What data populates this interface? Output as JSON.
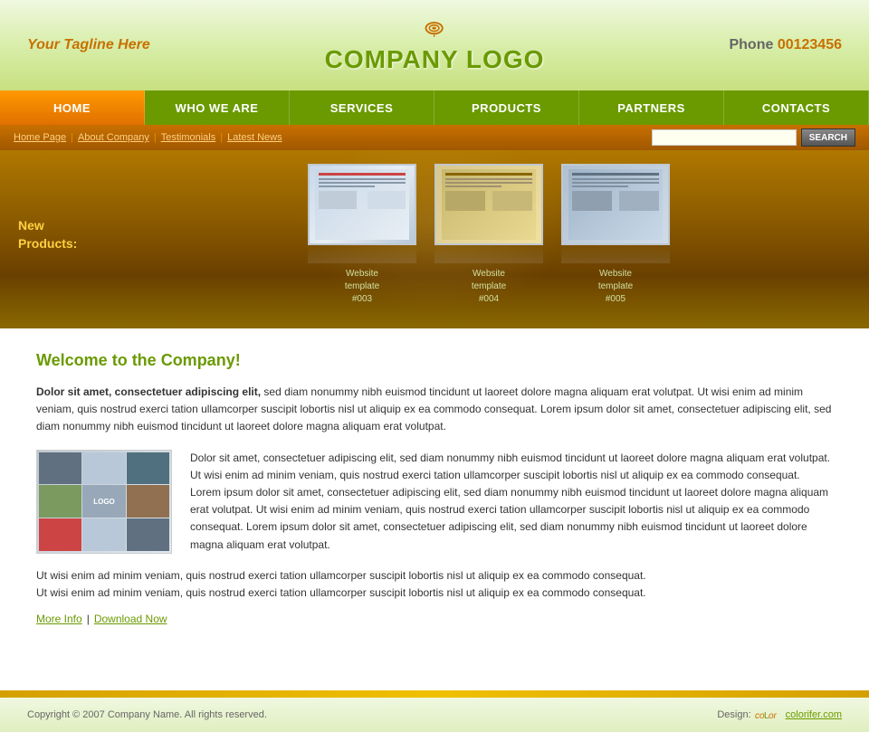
{
  "header": {
    "tagline": "Your Tagline Here",
    "logo": "COMPANY LOGO",
    "phone_label": "Phone",
    "phone_number": "00123456"
  },
  "nav": {
    "items": [
      {
        "label": "HOME",
        "active": true
      },
      {
        "label": "WHO WE ARE",
        "active": false
      },
      {
        "label": "SERVICES",
        "active": false
      },
      {
        "label": "PRODUCTS",
        "active": false
      },
      {
        "label": "PARTNERS",
        "active": false
      },
      {
        "label": "CONTACTS",
        "active": false
      }
    ]
  },
  "subnav": {
    "items": [
      "Home Page",
      "About Company",
      "Testimonials",
      "Latest News"
    ],
    "search_placeholder": "",
    "search_button": "SEARCH"
  },
  "banner": {
    "label": "New\nProducts:",
    "items": [
      {
        "caption_line1": "Website",
        "caption_line2": "template",
        "caption_line3": "#003"
      },
      {
        "caption_line1": "Website",
        "caption_line2": "template",
        "caption_line3": "#004"
      },
      {
        "caption_line1": "Website",
        "caption_line2": "template",
        "caption_line3": "#005"
      }
    ]
  },
  "main": {
    "welcome_title": "Welcome to the Company!",
    "intro_bold": "Dolor sit amet, consectetuer adipiscing elit,",
    "intro_text": " sed diam nonummy nibh euismod tincidunt ut laoreet dolore magna aliquam erat volutpat. Ut wisi enim ad minim veniam, quis nostrud exerci tation ullamcorper suscipit lobortis nisl ut aliquip ex ea commodo consequat. Lorem ipsum dolor sit amet, consectetuer adipiscing elit, sed diam nonummy nibh euismod tincidunt ut laoreet dolore magna aliquam erat volutpat.",
    "content_text": "Dolor sit amet, consectetuer adipiscing elit, sed diam nonummy nibh euismod tincidunt ut laoreet dolore magna aliquam erat volutpat. Ut wisi enim ad minim veniam, quis nostrud exerci tation ullamcorper suscipit lobortis nisl ut aliquip ex ea commodo consequat. Lorem ipsum dolor sit amet, consectetuer adipiscing elit, sed diam nonummy nibh euismod tincidunt ut laoreet dolore magna aliquam erat volutpat. Ut wisi enim ad minim veniam, quis nostrud exerci tation ullamcorper suscipit lobortis nisl ut aliquip ex ea commodo consequat. Lorem ipsum dolor sit amet, consectetuer adipiscing elit, sed diam nonummy nibh euismod tincidunt ut laoreet dolore magna aliquam erat volutpat.",
    "bottom_text1": "Ut wisi enim ad minim veniam, quis nostrud exerci tation ullamcorper suscipit lobortis nisl ut aliquip ex ea commodo consequat.",
    "bottom_text2": "Ut wisi enim ad minim veniam, quis nostrud exerci tation ullamcorper suscipit lobortis nisl ut aliquip ex ea commodo consequat.",
    "link1": "More Info",
    "link2": "Download Now"
  },
  "footer": {
    "copyright": "Copyright © 2007 Company Name. All rights reserved.",
    "design_label": "Design:",
    "design_link": "colorifer.com"
  }
}
